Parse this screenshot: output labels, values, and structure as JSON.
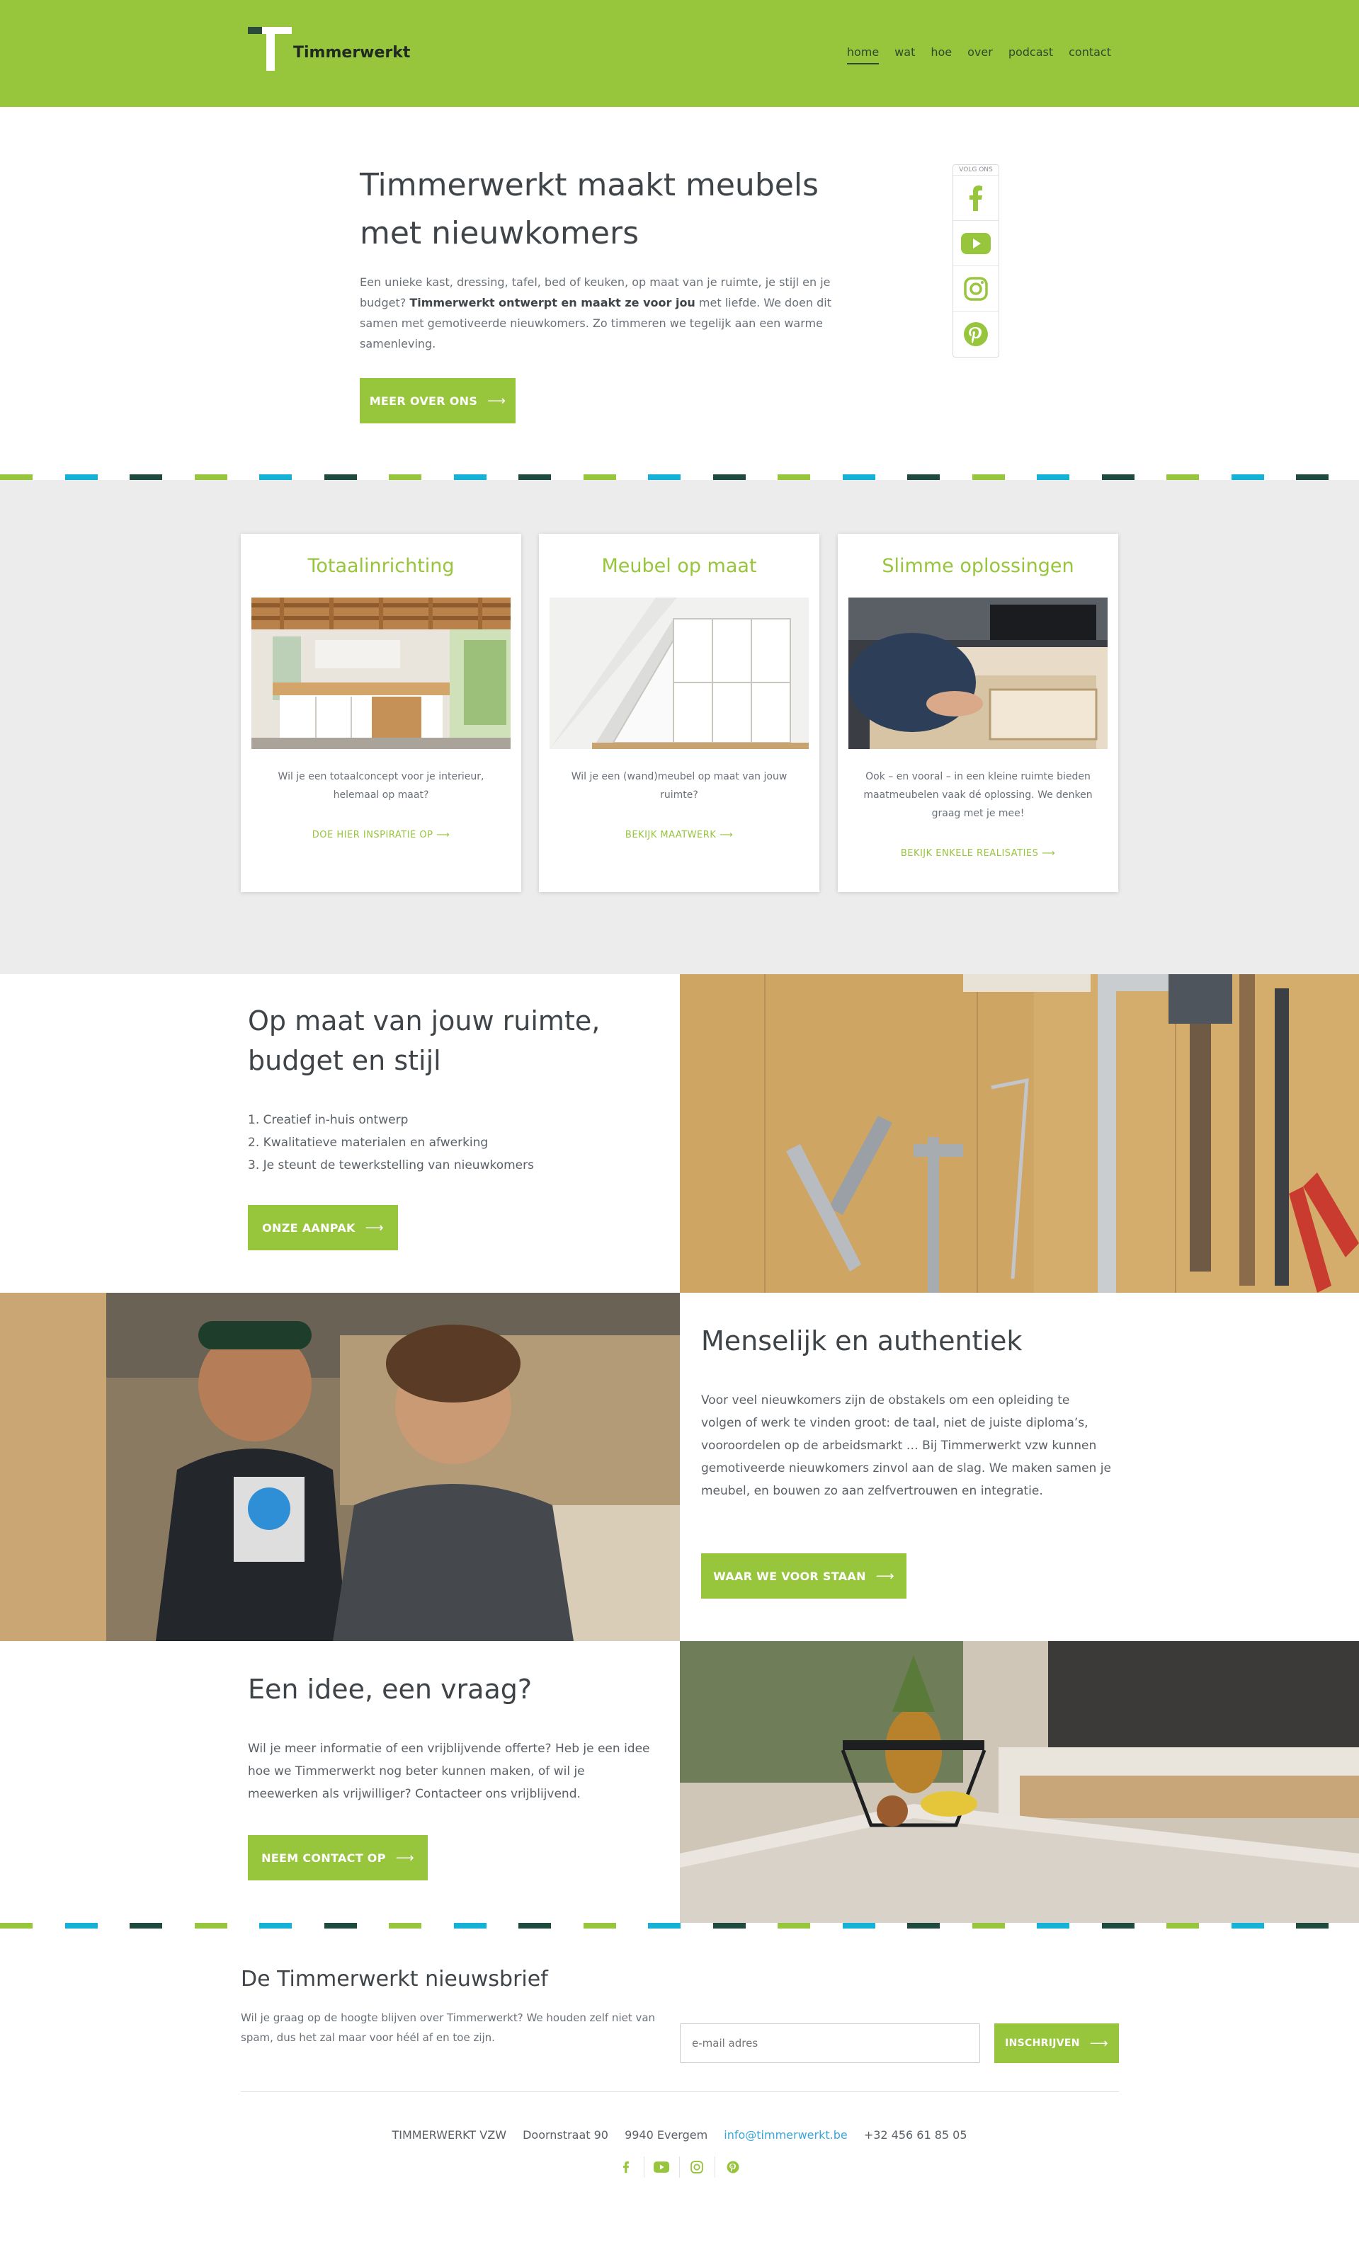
{
  "header": {
    "logo_text": "Timmerwerkt",
    "nav": [
      "home",
      "wat",
      "hoe",
      "over",
      "podcast",
      "contact"
    ],
    "active_nav": "home"
  },
  "hero": {
    "title_line1": "Timmerwerkt maakt meubels",
    "title_line2": "met nieuwkomers",
    "text_part1": "Een unieke kast, dressing, tafel, bed of keuken, op maat van je ruimte, je stijl en je budget? ",
    "text_bold": "Timmerwerkt ontwerpt en maakt ze voor jou",
    "text_part2": " met liefde. We doen dit samen met gemotiveerde nieuwkomers. Zo timmeren we tegelijk aan een warme samenleving.",
    "button": "MEER OVER ONS",
    "social_label": "VOLG ONS",
    "social_icons": [
      "facebook-icon",
      "youtube-icon",
      "instagram-icon",
      "pinterest-icon"
    ]
  },
  "services": [
    {
      "title": "Totaalinrichting",
      "text": "Wil je een totaalconcept voor je interieur, helemaal op maat?",
      "link": "DOE HIER INSPIRATIE OP"
    },
    {
      "title": "Meubel op maat",
      "text": "Wil je een (wand)meubel op maat van jouw ruimte?",
      "link": "BEKIJK MAATWERK"
    },
    {
      "title": "Slimme oplossingen",
      "text": "Ook – en vooral – in een kleine ruimte bieden maatmeubelen vaak dé oplossing. We denken graag met je mee!",
      "link": "BEKIJK ENKELE REALISATIES"
    }
  ],
  "feature1": {
    "title_line1": "Op maat van jouw ruimte,",
    "title_line2": "budget en stijl",
    "list": [
      "1. Creatief in-huis ontwerp",
      "2. Kwalitatieve materialen en afwerking",
      "3. Je steunt de tewerkstelling van nieuwkomers"
    ],
    "button": "ONZE AANPAK"
  },
  "feature2": {
    "title": "Menselijk en authentiek",
    "text": "Voor veel nieuwkomers zijn de obstakels om een opleiding te volgen of werk te vinden groot: de taal, niet de juiste diploma’s, vooroordelen op de arbeidsmarkt … Bij Timmerwerkt vzw kunnen gemotiveerde nieuwkomers zinvol aan de slag. We maken samen je meubel, en bouwen zo aan zelfvertrouwen en integratie.",
    "button": "WAAR WE VOOR STAAN"
  },
  "feature3": {
    "title": "Een idee, een vraag?",
    "text": "Wil je meer informatie of een vrijblijvende offerte? Heb je een idee hoe we Timmerwerkt nog beter kunnen maken, of wil je meewerken als vrijwilliger? Contacteer ons vrijblijvend.",
    "button": "NEEM CONTACT OP"
  },
  "newsletter": {
    "title": "De Timmerwerkt nieuwsbrief",
    "text": "Wil je graag op de hoogte blijven over Timmerwerkt? We houden zelf niet van spam, dus het zal maar voor héél af en toe zijn.",
    "placeholder": "e-mail adres",
    "button": "INSCHRIJVEN"
  },
  "footer": {
    "org": "TIMMERWERKT VZW",
    "street": "Doornstraat 90",
    "city": "9940 Evergem",
    "email": "info@timmerwerkt.be",
    "phone": "+32 456 61 85 05"
  },
  "colors": {
    "brand_green": "#97c53c",
    "dash_blue": "#16b1d6",
    "dash_dark": "#1f4a40",
    "card_bg": "#ececec"
  }
}
